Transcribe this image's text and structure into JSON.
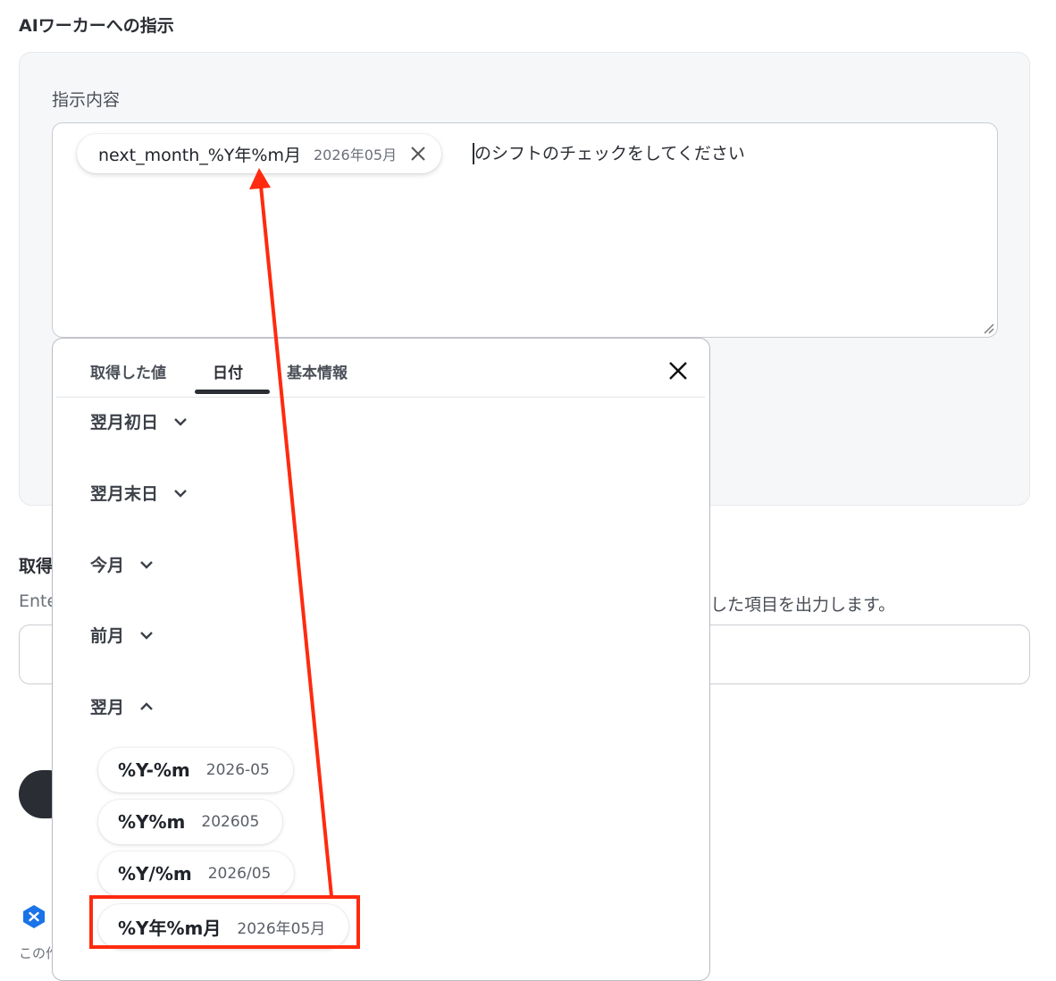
{
  "section": {
    "title": "AIワーカーへの指示",
    "field_label": "指示内容"
  },
  "chip": {
    "name": "next_month_%Y年%m月",
    "value": "2026年05月",
    "close_icon": "close-icon"
  },
  "instruction_text_after_chip": "のシフトのチェックをしてください",
  "below": {
    "title_partial": "取得",
    "desc_left_partial": "Ente",
    "desc_right_partial": "した項目を出力します。",
    "footer_partial": "この作"
  },
  "dropdown": {
    "tabs": [
      {
        "label": "取得した値"
      },
      {
        "label": "日付"
      },
      {
        "label": "基本情報"
      }
    ],
    "active_tab": "日付",
    "groups": [
      {
        "label": "翌月初日",
        "expanded": false
      },
      {
        "label": "翌月末日",
        "expanded": false
      },
      {
        "label": "今月",
        "expanded": false
      },
      {
        "label": "前月",
        "expanded": false
      },
      {
        "label": "翌月",
        "expanded": true
      }
    ],
    "formats": [
      {
        "name": "%Y-%m",
        "value": "2026-05"
      },
      {
        "name": "%Y%m",
        "value": "202605"
      },
      {
        "name": "%Y/%m",
        "value": "2026/05"
      },
      {
        "name": "%Y年%m月",
        "value": "2026年05月"
      }
    ]
  },
  "colors": {
    "annotation": "#ff2a0f",
    "badge": "#1a73e8",
    "dark_button": "#2a2d33"
  }
}
